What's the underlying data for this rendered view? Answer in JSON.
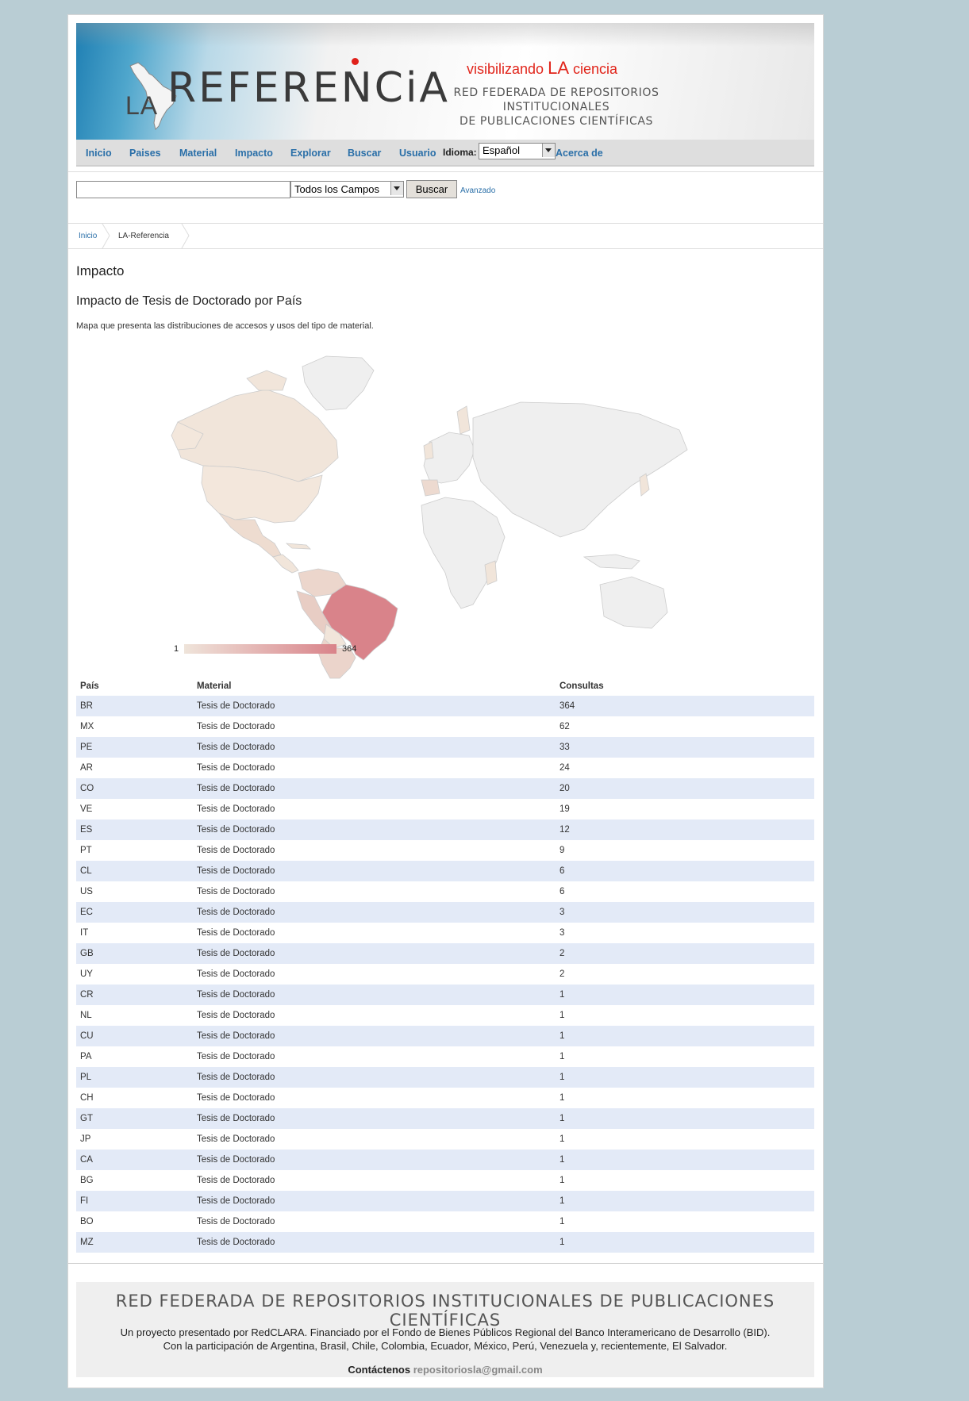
{
  "header": {
    "logo_la": "LA",
    "logo_referencia": "REFERENCiA",
    "tagline_pre": "visibilizando",
    "tagline_la": "LA",
    "tagline_post": "ciencia",
    "subtitle_line1": "RED FEDERADA DE REPOSITORIOS INSTITUCIONALES",
    "subtitle_line2": "DE PUBLICACIONES CIENTÍFICAS"
  },
  "nav": {
    "items": [
      "Inicio",
      "Paises",
      "Material",
      "Impacto",
      "Explorar",
      "Buscar",
      "Usuario"
    ],
    "idioma_label": "Idioma:",
    "idioma_value": "Español",
    "about": "Acerca de"
  },
  "search": {
    "query": "",
    "field_value": "Todos los Campos",
    "button": "Buscar",
    "advanced": "Avanzado"
  },
  "breadcrumb": {
    "home": "Inicio",
    "current": "LA-Referencia"
  },
  "main": {
    "title": "Impacto",
    "subtitle": "Impacto de Tesis de Doctorado por País",
    "description": "Mapa que presenta las distribuciones de accesos y usos del tipo de material."
  },
  "map_legend": {
    "min": "1",
    "max": "364"
  },
  "colors": {
    "scale_low": "#efe4da",
    "scale_high": "#d9838a",
    "link": "#2a6fa8",
    "accent_red": "#e1251b"
  },
  "table": {
    "headers": [
      "País",
      "Material",
      "Consultas"
    ],
    "rows": [
      [
        "BR",
        "Tesis de Doctorado",
        "364"
      ],
      [
        "MX",
        "Tesis de Doctorado",
        "62"
      ],
      [
        "PE",
        "Tesis de Doctorado",
        "33"
      ],
      [
        "AR",
        "Tesis de Doctorado",
        "24"
      ],
      [
        "CO",
        "Tesis de Doctorado",
        "20"
      ],
      [
        "VE",
        "Tesis de Doctorado",
        "19"
      ],
      [
        "ES",
        "Tesis de Doctorado",
        "12"
      ],
      [
        "PT",
        "Tesis de Doctorado",
        "9"
      ],
      [
        "CL",
        "Tesis de Doctorado",
        "6"
      ],
      [
        "US",
        "Tesis de Doctorado",
        "6"
      ],
      [
        "EC",
        "Tesis de Doctorado",
        "3"
      ],
      [
        "IT",
        "Tesis de Doctorado",
        "3"
      ],
      [
        "GB",
        "Tesis de Doctorado",
        "2"
      ],
      [
        "UY",
        "Tesis de Doctorado",
        "2"
      ],
      [
        "CR",
        "Tesis de Doctorado",
        "1"
      ],
      [
        "NL",
        "Tesis de Doctorado",
        "1"
      ],
      [
        "CU",
        "Tesis de Doctorado",
        "1"
      ],
      [
        "PA",
        "Tesis de Doctorado",
        "1"
      ],
      [
        "PL",
        "Tesis de Doctorado",
        "1"
      ],
      [
        "CH",
        "Tesis de Doctorado",
        "1"
      ],
      [
        "GT",
        "Tesis de Doctorado",
        "1"
      ],
      [
        "JP",
        "Tesis de Doctorado",
        "1"
      ],
      [
        "CA",
        "Tesis de Doctorado",
        "1"
      ],
      [
        "BG",
        "Tesis de Doctorado",
        "1"
      ],
      [
        "FI",
        "Tesis de Doctorado",
        "1"
      ],
      [
        "BO",
        "Tesis de Doctorado",
        "1"
      ],
      [
        "MZ",
        "Tesis de Doctorado",
        "1"
      ]
    ]
  },
  "footer": {
    "title": "RED FEDERADA DE REPOSITORIOS INSTITUCIONALES DE PUBLICACIONES CIENTÍFICAS",
    "line1": "Un proyecto presentado por RedCLARA. Financiado por el Fondo de Bienes Públicos Regional del Banco Interamericano de Desarrollo (BID).",
    "line2": "Con la participación de Argentina, Brasil, Chile, Colombia, Ecuador, México, Perú, Venezuela y, recientemente, El Salvador.",
    "contact_label": "Contáctenos",
    "contact_email": "repositoriosla@gmail.com"
  }
}
